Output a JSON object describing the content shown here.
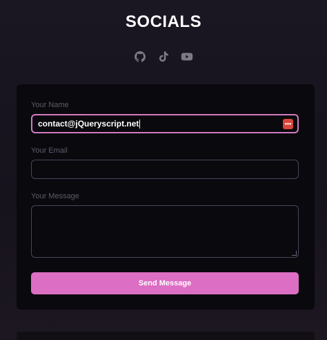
{
  "header": {
    "title": "SOCIALS"
  },
  "socials": {
    "icons": [
      "github-icon",
      "tiktok-icon",
      "youtube-icon"
    ]
  },
  "form": {
    "name_label": "Your Name",
    "name_value": "contact@jQueryscript.net",
    "email_label": "Your Email",
    "email_value": "",
    "message_label": "Your Message",
    "message_value": "",
    "submit_label": "Send Message",
    "autofill_glyph": "•••"
  },
  "colors": {
    "accent": "#dc6ec3",
    "focus_border": "#d27cc3",
    "autofill_badge": "#d8463c",
    "background": "#18141f",
    "card": "#0a090d"
  }
}
